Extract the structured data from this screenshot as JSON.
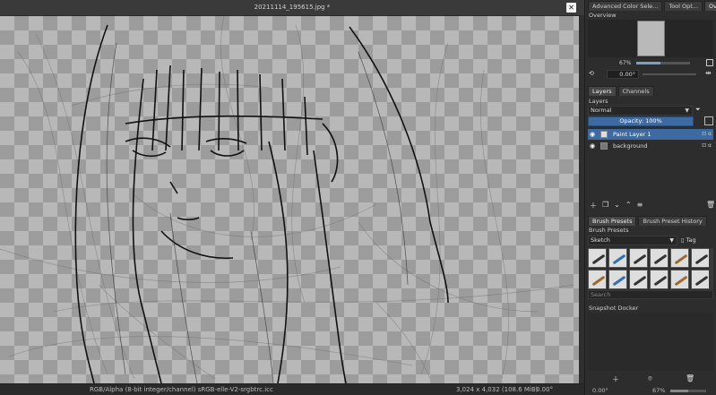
{
  "document": {
    "title": "20211114_195615.jpg *",
    "close_glyph": "✕"
  },
  "statusbar": {
    "color_profile": "RGB/Alpha (8-bit integer/channel)  sRGB-elle-V2-srgbtrc.icc",
    "image_size": "3,024 x 4,032 (108.6 MiB)",
    "rotation": "0.00°"
  },
  "top_tabs": [
    "Advanced Color Sele...",
    "Tool Opt...",
    "Over..."
  ],
  "overview": {
    "label": "Overview",
    "zoom": "67%",
    "rotation": "0.00°"
  },
  "layers_tabs": [
    "Layers",
    "Channels"
  ],
  "layers": {
    "label": "Layers",
    "blend_mode": "Normal",
    "opacity": "Opacity:  100%",
    "items": [
      {
        "name": "Paint Layer 1",
        "selected": true
      },
      {
        "name": "background",
        "selected": false
      }
    ]
  },
  "brush_tabs": [
    "Brush Presets",
    "Brush Preset History"
  ],
  "brush_presets": {
    "label": "Brush Presets",
    "filter": "Sketch",
    "tag": "Tag",
    "search_placeholder": "Search",
    "brush_count": 12
  },
  "snapshot": {
    "label": "Snapshot Docker"
  },
  "dock_status": {
    "rotation": "0.00°",
    "zoom": "67%"
  },
  "icons": [
    "close-icon",
    "eye-icon",
    "filter-icon",
    "add-layer-icon",
    "duplicate-icon",
    "move-down-icon",
    "move-up-icon",
    "properties-icon",
    "delete-icon",
    "camera-icon",
    "mirror-icon",
    "rotate-icon"
  ]
}
